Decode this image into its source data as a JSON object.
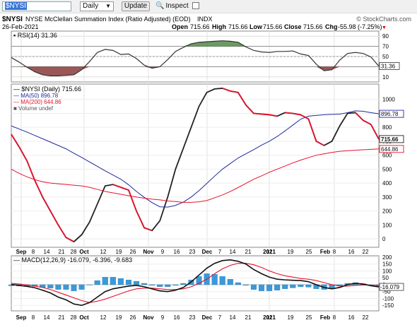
{
  "toolbar": {
    "symbol_value": "$NYSI",
    "period_value": "Daily",
    "update_label": "Update",
    "inspect_label": "Inspect"
  },
  "header": {
    "symbol": "$NYSI",
    "name": "NYSE McClellan Summation Index (Ratio Adjusted) (EOD)",
    "exchange": "INDX",
    "copyright": "© StockCharts.com",
    "date": "26-Feb-2021",
    "open_label": "Open",
    "open": "715.66",
    "high_label": "High",
    "high": "715.66",
    "low_label": "Low",
    "low": "715.66",
    "close_label": "Close",
    "close": "715.66",
    "chg_label": "Chg",
    "chg": "-55.98 (-7.25%)",
    "chg_arrow": "▼"
  },
  "colors": {
    "price": "#e8112d",
    "ma50": "#1f2a9c",
    "ma200": "#e8112d",
    "rsi": "#333333",
    "rsi_overbought_fill": "#3b7a2e",
    "rsi_oversold_fill": "#7a1f1f",
    "macd": "#111111",
    "macd_signal": "#e8112d",
    "histogram": "#3a9ad9"
  },
  "x_labels": {
    "bottom": [
      "Sep",
      "8",
      "14",
      "21",
      "28",
      "Oct",
      "12",
      "19",
      "26",
      "Nov",
      "9",
      "16",
      "23",
      "Dec",
      "7",
      "14",
      "21",
      "28",
      "2021",
      "11",
      "19",
      "25",
      "Feb",
      "8",
      "16",
      "22"
    ]
  },
  "chart_data": [
    {
      "type": "line",
      "title": "RSI(14) 31.36",
      "series": [
        {
          "name": "RSI(14)",
          "last": 31.36,
          "values": [
            48,
            39,
            29,
            20,
            14,
            12,
            12,
            13,
            14,
            24,
            40,
            58,
            64,
            62,
            54,
            55,
            46,
            33,
            27,
            30,
            44,
            60,
            68,
            75,
            78,
            79,
            80,
            81,
            80,
            78,
            69,
            62,
            59,
            58,
            60,
            60,
            61,
            55,
            52,
            35,
            22,
            24,
            43,
            56,
            58,
            56,
            49,
            31
          ]
        }
      ],
      "yticks": [
        10,
        30,
        50,
        70,
        90
      ],
      "ylim": [
        0,
        100
      ],
      "overbought": 70,
      "oversold": 30
    },
    {
      "type": "line",
      "title": "$NYSI (Daily) 715.66",
      "series": [
        {
          "name": "$NYSI (Daily)",
          "last": 715.66,
          "values": [
            750,
            660,
            560,
            420,
            300,
            200,
            100,
            10,
            -20,
            30,
            120,
            250,
            380,
            390,
            370,
            350,
            200,
            80,
            60,
            130,
            300,
            500,
            650,
            800,
            950,
            1050,
            1075,
            1080,
            1060,
            1050,
            960,
            900,
            895,
            890,
            880,
            905,
            900,
            890,
            860,
            700,
            670,
            700,
            810,
            900,
            905,
            850,
            820,
            715
          ]
        },
        {
          "name": "MA(50)",
          "last": 896.78,
          "values": [
            810,
            788,
            766,
            742,
            718,
            694,
            670,
            646,
            614,
            584,
            552,
            520,
            488,
            458,
            428,
            388,
            340,
            298,
            260,
            230,
            228,
            240,
            264,
            300,
            346,
            398,
            450,
            500,
            540,
            580,
            610,
            640,
            672,
            700,
            734,
            774,
            816,
            858,
            880,
            885,
            890,
            893,
            895,
            905,
            918,
            915,
            905,
            897
          ]
        },
        {
          "name": "MA(200)",
          "last": 644.86,
          "values": [
            500,
            470,
            445,
            425,
            410,
            400,
            395,
            390,
            385,
            380,
            370,
            355,
            340,
            330,
            320,
            310,
            300,
            292,
            285,
            280,
            272,
            268,
            262,
            262,
            266,
            275,
            295,
            315,
            340,
            368,
            398,
            428,
            452,
            478,
            500,
            522,
            545,
            565,
            583,
            600,
            610,
            620,
            628,
            632,
            636,
            639,
            642,
            645
          ]
        }
      ],
      "legend_extra": "Volume undef",
      "yticks": [
        0,
        100,
        200,
        300,
        400,
        500,
        600,
        700,
        800,
        900,
        1000
      ],
      "ylim": [
        -60,
        1110
      ],
      "last_labels": [
        "896.78",
        "715.66",
        "644.86"
      ]
    },
    {
      "type": "line",
      "title": "MACD(12,26,9) -16.079, -6.396, -9.683",
      "series": [
        {
          "name": "MACD(12,26,9)",
          "last": -16.079,
          "values": [
            2,
            -5,
            -12,
            -22,
            -40,
            -60,
            -90,
            -110,
            -140,
            -150,
            -130,
            -90,
            -50,
            -30,
            -20,
            -10,
            -5,
            -15,
            -30,
            -45,
            -50,
            -40,
            -20,
            20,
            70,
            120,
            155,
            175,
            180,
            170,
            150,
            110,
            80,
            55,
            40,
            35,
            32,
            30,
            22,
            0,
            -20,
            -30,
            -20,
            0,
            10,
            5,
            -8,
            -16
          ]
        },
        {
          "name": "Signal",
          "last": -6.396,
          "values": [
            10,
            5,
            -2,
            -10,
            -20,
            -35,
            -55,
            -75,
            -95,
            -115,
            -130,
            -120,
            -105,
            -85,
            -65,
            -45,
            -30,
            -25,
            -25,
            -30,
            -35,
            -35,
            -30,
            -15,
            10,
            40,
            80,
            115,
            140,
            155,
            155,
            145,
            125,
            100,
            80,
            65,
            55,
            45,
            40,
            30,
            15,
            0,
            -10,
            -10,
            -5,
            -2,
            -4,
            -6
          ]
        },
        {
          "name": "Histogram",
          "last": -9.683,
          "values": [
            -8,
            -10,
            -10,
            -12,
            -20,
            -25,
            -35,
            -35,
            -45,
            -35,
            0,
            30,
            55,
            55,
            45,
            35,
            25,
            10,
            -5,
            -15,
            -15,
            -5,
            10,
            35,
            60,
            80,
            75,
            60,
            40,
            15,
            -5,
            -35,
            -45,
            -45,
            -40,
            -30,
            -23,
            -15,
            -18,
            -30,
            -35,
            -30,
            -10,
            10,
            15,
            7,
            -4,
            -10
          ]
        }
      ],
      "yticks": [
        -150,
        -100,
        -50,
        0,
        50,
        100,
        150,
        200
      ],
      "ylim": [
        -190,
        210
      ]
    }
  ]
}
